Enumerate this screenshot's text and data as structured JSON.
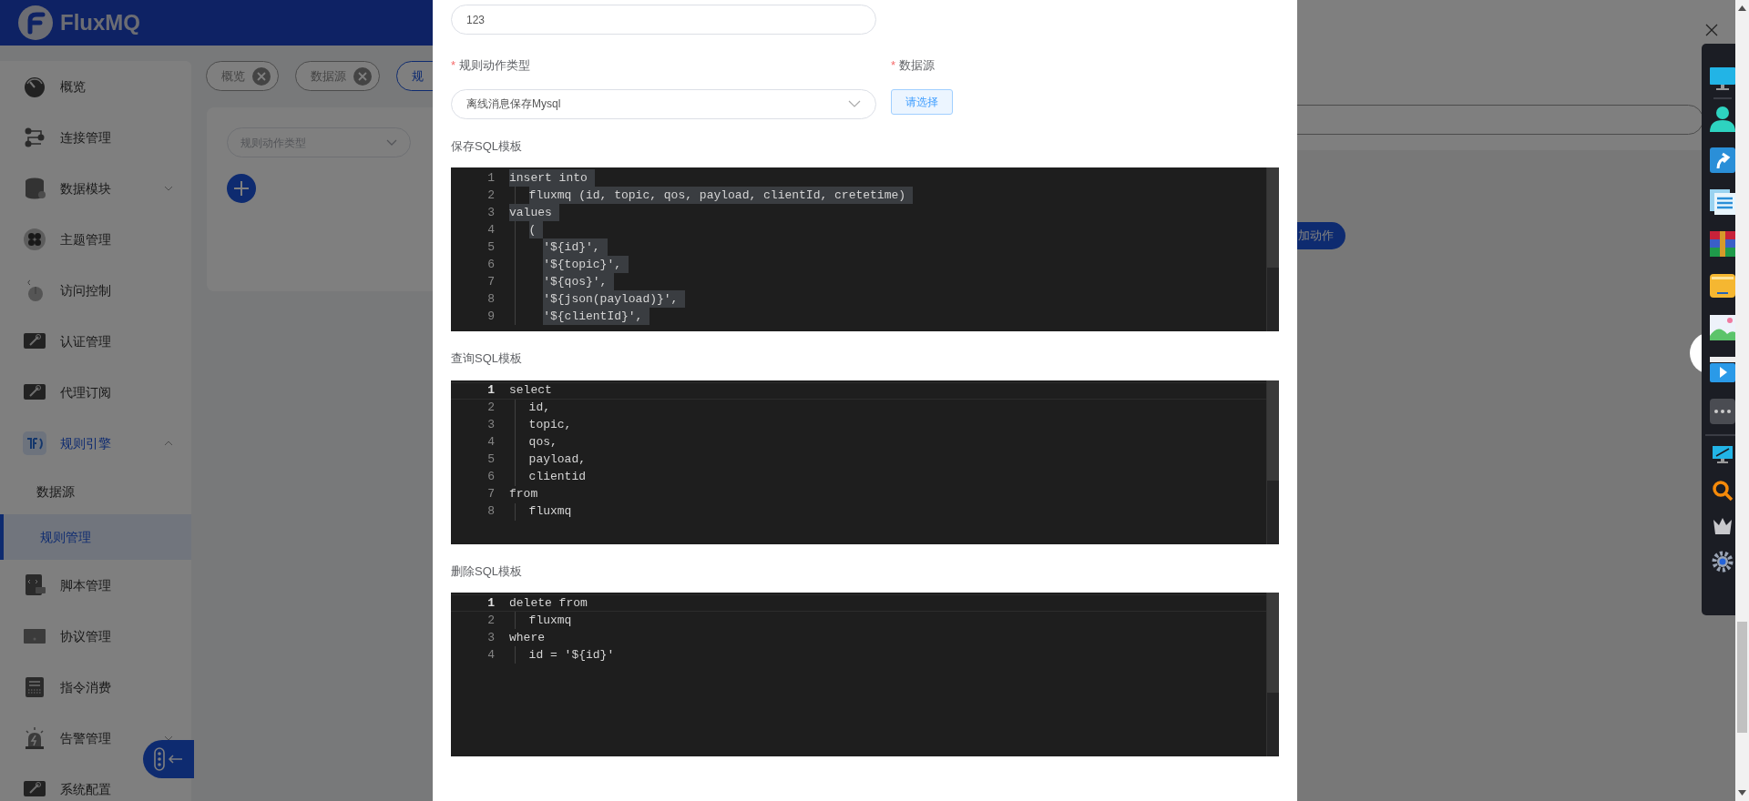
{
  "header": {
    "logo_text": "FluxMQ"
  },
  "sidebar": {
    "items": [
      {
        "label": "概览",
        "selected": false
      },
      {
        "label": "连接管理",
        "selected": false
      },
      {
        "label": "数据模块",
        "selected": false,
        "expanded": false
      },
      {
        "label": "主题管理",
        "selected": false
      },
      {
        "label": "访问控制",
        "selected": false
      },
      {
        "label": "认证管理",
        "selected": false
      },
      {
        "label": "代理订阅",
        "selected": false
      },
      {
        "label": "规则引擎",
        "selected": true,
        "expanded": true,
        "children": [
          {
            "label": "数据源",
            "selected": false
          },
          {
            "label": "规则管理",
            "selected": true
          }
        ]
      },
      {
        "label": "脚本管理",
        "selected": false
      },
      {
        "label": "协议管理",
        "selected": false
      },
      {
        "label": "指令消费",
        "selected": false
      },
      {
        "label": "告警管理",
        "selected": false,
        "expanded": false
      },
      {
        "label": "系统配置",
        "selected": false
      }
    ]
  },
  "tabs": [
    {
      "label": "概览",
      "selected": false
    },
    {
      "label": "数据源",
      "selected": false
    },
    {
      "label": "规",
      "selected": true
    }
  ],
  "content": {
    "select_placeholder": "规则动作类型"
  },
  "drawer": {
    "button": "加动作"
  },
  "modal": {
    "name_field": {
      "value": "123"
    },
    "action_type": {
      "required_mark": "*",
      "label": "规则动作类型",
      "value": "离线消息保存Mysql"
    },
    "datasource": {
      "required_mark": "*",
      "label": "数据源",
      "button": "请选择"
    },
    "editors": [
      {
        "label": "保存SQL模板",
        "lines": [
          {
            "number": "1",
            "text": "insert into",
            "current": false,
            "highlighted": true
          },
          {
            "number": "2",
            "text": "  fluxmq (id, topic, qos, payload, clientId, cretetime)",
            "current": false,
            "highlighted": true
          },
          {
            "number": "3",
            "text": "values",
            "current": false,
            "highlighted": true
          },
          {
            "number": "4",
            "text": "  (",
            "current": false,
            "highlighted": true
          },
          {
            "number": "5",
            "text": "    '${id}',",
            "current": false,
            "highlighted": true
          },
          {
            "number": "6",
            "text": "    '${topic}',",
            "current": false,
            "highlighted": true
          },
          {
            "number": "7",
            "text": "    '${qos}',",
            "current": false,
            "highlighted": true
          },
          {
            "number": "8",
            "text": "    '${json(payload)}',",
            "current": false,
            "highlighted": true
          },
          {
            "number": "9",
            "text": "    '${clientId}',",
            "current": false,
            "highlighted": true
          }
        ]
      },
      {
        "label": "查询SQL模板",
        "lines": [
          {
            "number": "1",
            "text": "select",
            "current": true,
            "highlighted": false
          },
          {
            "number": "2",
            "text": "  id,",
            "current": false,
            "highlighted": false
          },
          {
            "number": "3",
            "text": "  topic,",
            "current": false,
            "highlighted": false
          },
          {
            "number": "4",
            "text": "  qos,",
            "current": false,
            "highlighted": false
          },
          {
            "number": "5",
            "text": "  payload,",
            "current": false,
            "highlighted": false
          },
          {
            "number": "6",
            "text": "  clientid",
            "current": false,
            "highlighted": false
          },
          {
            "number": "7",
            "text": "from",
            "current": false,
            "highlighted": false
          },
          {
            "number": "8",
            "text": "  fluxmq",
            "current": false,
            "highlighted": false
          }
        ]
      },
      {
        "label": "删除SQL模板",
        "lines": [
          {
            "number": "1",
            "text": "delete from",
            "current": true,
            "highlighted": false
          },
          {
            "number": "2",
            "text": "  fluxmq",
            "current": false,
            "highlighted": false
          },
          {
            "number": "3",
            "text": "where",
            "current": false,
            "highlighted": false
          },
          {
            "number": "4",
            "text": "  id = '${id}'",
            "current": false,
            "highlighted": false
          }
        ]
      }
    ]
  }
}
